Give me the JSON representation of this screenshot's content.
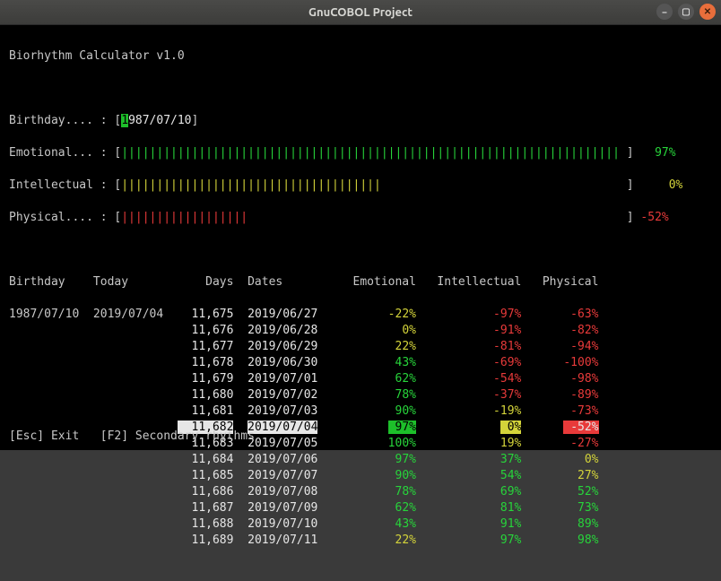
{
  "window": {
    "title": "GnuCOBOL Project"
  },
  "app": {
    "title": "Biorhythm Calculator v1.0"
  },
  "inputs": {
    "birthday_label": "Birthday.... : [",
    "birthday_value": "1987/07/10",
    "birthday_close": "]"
  },
  "bars": {
    "emotional": {
      "label": "Emotional... :",
      "l": "[",
      "r": "]",
      "value": "97%"
    },
    "intellectual": {
      "label": "Intellectual :",
      "l": "[",
      "r": "]",
      "value": "0%"
    },
    "physical": {
      "label": "Physical.... :",
      "l": "[",
      "r": "]",
      "value": "-52%"
    }
  },
  "bar_ticks": {
    "emotional_green_n": 71,
    "intellectual_yellow_n": 37,
    "physical_red_n": 18
  },
  "headers": {
    "birthday": "Birthday",
    "today": "Today",
    "days": "Days",
    "dates": "Dates",
    "emotional": "Emotional",
    "intellectual": "Intellectual",
    "physical": "Physical"
  },
  "fixed": {
    "birthday": "1987/07/10",
    "today": "2019/07/04"
  },
  "rows": [
    {
      "days": "11,675",
      "date": "2019/06/27",
      "e": "-22%",
      "i": "-97%",
      "p": "-63%",
      "hl": false,
      "ec": "y",
      "ic": "r",
      "pc": "r"
    },
    {
      "days": "11,676",
      "date": "2019/06/28",
      "e": "0%",
      "i": "-91%",
      "p": "-82%",
      "hl": false,
      "ec": "y",
      "ic": "r",
      "pc": "r"
    },
    {
      "days": "11,677",
      "date": "2019/06/29",
      "e": "22%",
      "i": "-81%",
      "p": "-94%",
      "hl": false,
      "ec": "y",
      "ic": "r",
      "pc": "r"
    },
    {
      "days": "11,678",
      "date": "2019/06/30",
      "e": "43%",
      "i": "-69%",
      "p": "-100%",
      "hl": false,
      "ec": "g",
      "ic": "r",
      "pc": "r"
    },
    {
      "days": "11,679",
      "date": "2019/07/01",
      "e": "62%",
      "i": "-54%",
      "p": "-98%",
      "hl": false,
      "ec": "g",
      "ic": "r",
      "pc": "r"
    },
    {
      "days": "11,680",
      "date": "2019/07/02",
      "e": "78%",
      "i": "-37%",
      "p": "-89%",
      "hl": false,
      "ec": "g",
      "ic": "r",
      "pc": "r"
    },
    {
      "days": "11,681",
      "date": "2019/07/03",
      "e": "90%",
      "i": "-19%",
      "p": "-73%",
      "hl": false,
      "ec": "g",
      "ic": "y",
      "pc": "r"
    },
    {
      "days": "11,682",
      "date": "2019/07/04",
      "e": "97%",
      "i": "0%",
      "p": "-52%",
      "hl": true
    },
    {
      "days": "11,683",
      "date": "2019/07/05",
      "e": "100%",
      "i": "19%",
      "p": "-27%",
      "hl": false,
      "ec": "g",
      "ic": "y",
      "pc": "r"
    },
    {
      "days": "11,684",
      "date": "2019/07/06",
      "e": "97%",
      "i": "37%",
      "p": "0%",
      "hl": false,
      "ec": "g",
      "ic": "g",
      "pc": "y"
    },
    {
      "days": "11,685",
      "date": "2019/07/07",
      "e": "90%",
      "i": "54%",
      "p": "27%",
      "hl": false,
      "ec": "g",
      "ic": "g",
      "pc": "y"
    },
    {
      "days": "11,686",
      "date": "2019/07/08",
      "e": "78%",
      "i": "69%",
      "p": "52%",
      "hl": false,
      "ec": "g",
      "ic": "g",
      "pc": "g"
    },
    {
      "days": "11,687",
      "date": "2019/07/09",
      "e": "62%",
      "i": "81%",
      "p": "73%",
      "hl": false,
      "ec": "g",
      "ic": "g",
      "pc": "g"
    },
    {
      "days": "11,688",
      "date": "2019/07/10",
      "e": "43%",
      "i": "91%",
      "p": "89%",
      "hl": false,
      "ec": "g",
      "ic": "g",
      "pc": "g"
    },
    {
      "days": "11,689",
      "date": "2019/07/11",
      "e": "22%",
      "i": "97%",
      "p": "98%",
      "hl": false,
      "ec": "y",
      "ic": "g",
      "pc": "g"
    }
  ],
  "footer": {
    "exit": "[Esc] Exit",
    "secondary": "[F2] Secondary rhythms"
  }
}
